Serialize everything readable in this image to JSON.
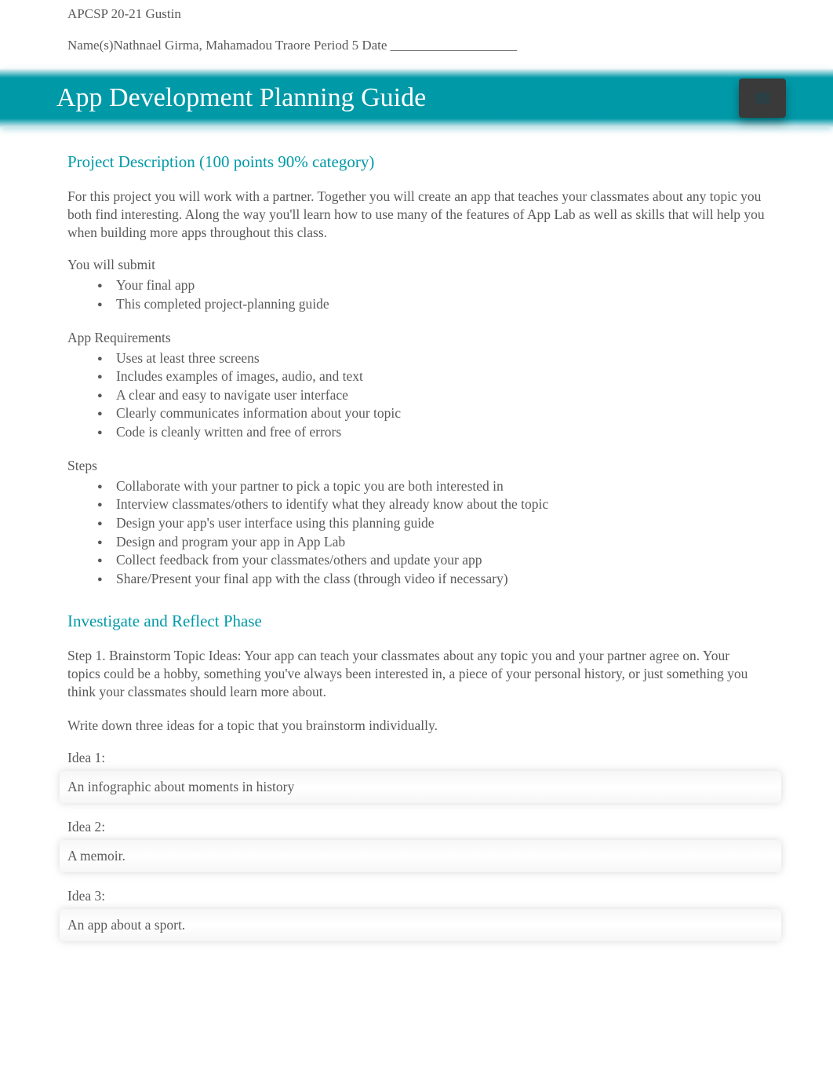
{
  "header": {
    "course": "APCSP 20-21 Gustin",
    "nameline": "Name(s)Nathnael Girma, Mahamadou Traore Period 5 Date ___________________"
  },
  "title": "App Development Planning Guide",
  "section1": {
    "heading": "Project Description (100 points 90% category)",
    "intro": "For this project you will work with a partner. Together you will create an app that teaches your classmates about any topic you both find interesting. Along the way you'll learn how to use many of the features of App Lab as well as skills that will help you when building more apps throughout this class.",
    "submit_label": "You will submit",
    "submit_items": [
      "Your final app",
      "This completed project-planning guide"
    ],
    "req_label": "App Requirements",
    "req_items": [
      "Uses at least three     screens",
      "Includes examples of images, audio, and text",
      "A clear and easy to navigate user interface",
      "Clearly communicates information about your topic",
      "Code is cleanly written and free of errors"
    ],
    "steps_label": "Steps",
    "steps_items": [
      "Collaborate with your partner to pick a topic you are both interested in",
      "Interview classmates/others to identify what they already know about the topic",
      "Design your app's user interface using this planning guide",
      "Design and program your app in App Lab",
      "Collect feedback from your classmates/others and update your app",
      "Share/Present your final app with the class (through video if necessary)"
    ]
  },
  "section2": {
    "heading": "Investigate and Reflect Phase",
    "step1": "Step 1. Brainstorm Topic Ideas:           Your app can teach your classmates about any topic you and your partner agree on. Your topics could be a hobby, something you've always been interested in, a piece of your personal history, or just something you think your classmates should learn more about.",
    "instruction": "Write down three ideas for a topic that you brainstorm individually.",
    "ideas": [
      {
        "label": "Idea 1:",
        "text": "An infographic about moments in history"
      },
      {
        "label": "Idea 2:",
        "text": "A memoir."
      },
      {
        "label": "Idea 3:",
        "text": "An app about a sport."
      }
    ]
  }
}
